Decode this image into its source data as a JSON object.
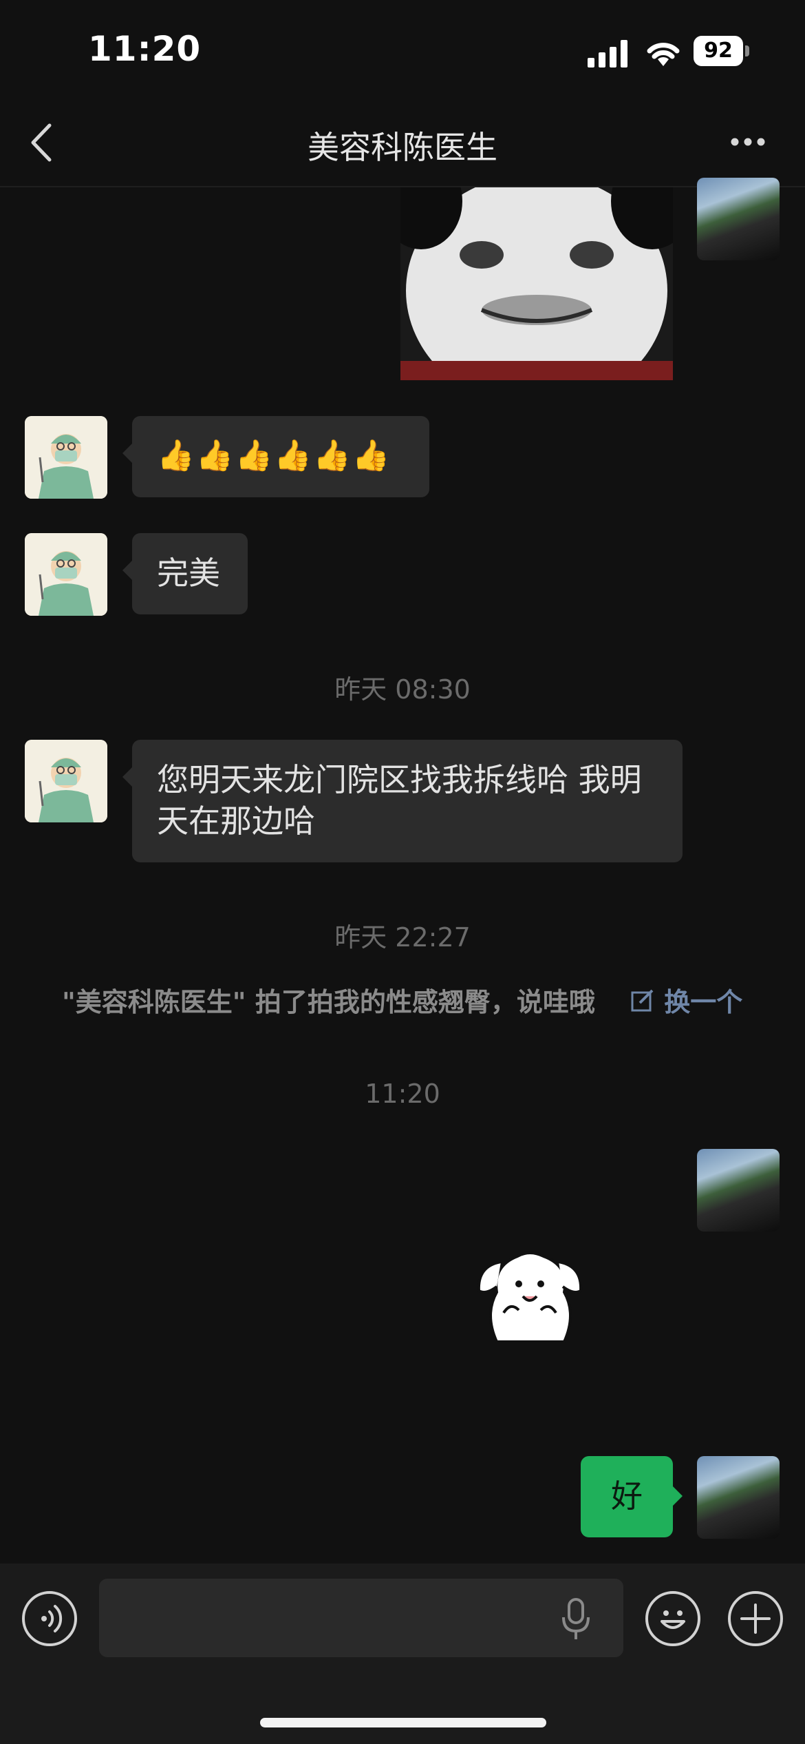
{
  "status_bar": {
    "time": "11:20",
    "battery": "92",
    "icons": [
      "signal-icon",
      "wifi-icon",
      "battery-icon"
    ]
  },
  "nav": {
    "back_icon": "chevron-left-icon",
    "title": "美容科陈医生",
    "more_icon": "more-dots-icon"
  },
  "messages": [
    {
      "side": "right",
      "type": "image",
      "content": "panda-face-meme-sticker"
    },
    {
      "side": "left",
      "type": "text",
      "text": "👍👍👍👍👍👍"
    },
    {
      "side": "left",
      "type": "text",
      "text": "完美"
    },
    {
      "type": "timestamp",
      "text": "昨天 08:30"
    },
    {
      "side": "left",
      "type": "text",
      "text": "您明天来龙门院区找我拆线哈 我明天在那边哈"
    },
    {
      "type": "timestamp",
      "text": "昨天 22:27"
    },
    {
      "type": "system",
      "text": "\"美容科陈医生\" 拍了拍我的性感翘臀，说哇哦",
      "link": "换一个",
      "link_icon": "edit-icon"
    },
    {
      "type": "timestamp",
      "text": "11:20"
    },
    {
      "side": "right",
      "type": "sticker",
      "content": "white-puppy-sticker"
    },
    {
      "side": "right",
      "type": "text",
      "text": "好"
    }
  ],
  "input_bar": {
    "voice_icon": "voice-icon",
    "mic_icon": "microphone-icon",
    "emoji_icon": "emoji-icon",
    "plus_icon": "plus-icon",
    "value": ""
  },
  "colors": {
    "background": "#111111",
    "bubble_incoming": "#2c2c2c",
    "bubble_outgoing": "#1fb05a",
    "link": "#6f86a8"
  }
}
